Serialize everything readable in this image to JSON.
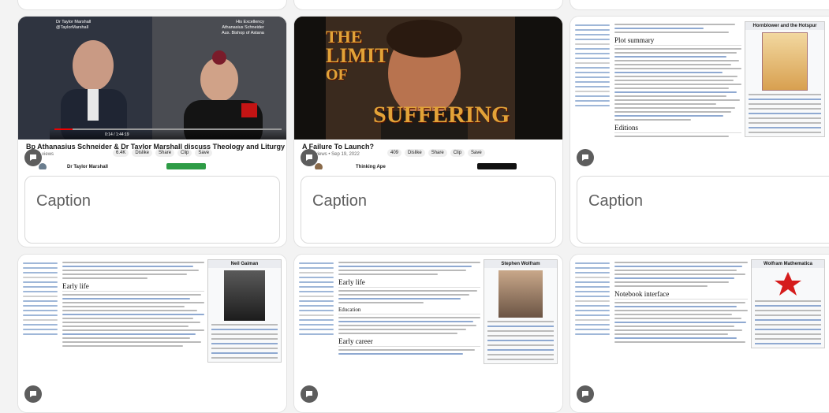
{
  "cards": {
    "caption_placeholder": "Caption",
    "video1": {
      "title": "Bp Athanasius Schneider & Dr Taylor Marshall discuss Theology and Liturgy",
      "meta": "86,726 views",
      "time": "0:14 / 1:44:19",
      "channel": "Dr Taylor Marshall",
      "left_tag": "Dr Taylor Marshall\n@TaylorMarshall",
      "right_tag": "His Excellency\nAthanasius Schneider\nAux. Bishop of Astana",
      "actions": [
        "6.4K",
        "Dislike",
        "Share",
        "Clip",
        "Save"
      ]
    },
    "video2": {
      "title": "A Failure To Launch?",
      "meta": "2,250 views • Sep 19, 2022",
      "channel": "Thinking Ape",
      "overlay_line1": "THE",
      "overlay_line2": "LIMIT",
      "overlay_line3": "OF",
      "overlay_line4": "SUFFERING",
      "actions": [
        "409",
        "Dislike",
        "Share",
        "Clip",
        "Save"
      ]
    },
    "wiki1": {
      "heading1": "Plot summary",
      "heading2": "Editions",
      "infobox_title": "Hornblower and the Hotspur"
    },
    "wiki2": {
      "heading1": "Early life",
      "infobox_title": "Neil Gaiman"
    },
    "wiki3": {
      "heading1": "Early life",
      "heading2": "Education",
      "heading3": "Early career",
      "infobox_title": "Stephen Wolfram"
    },
    "wiki4": {
      "heading1": "Notebook interface",
      "infobox_title": "Wolfram Mathematica"
    }
  },
  "colors": {
    "accent_red": "#e00000",
    "badge": "#5d5d5d",
    "subscribe_green": "#2e9c46"
  }
}
